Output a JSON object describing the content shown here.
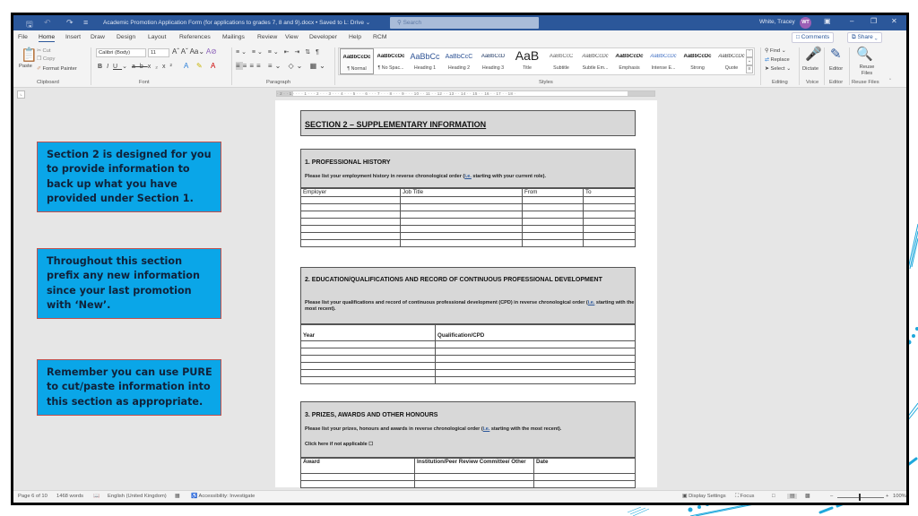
{
  "window": {
    "title": "Academic Promotion Application Form (for applications to grades 7, 8 and 9).docx • Saved to L: Drive ⌄",
    "search_placeholder": "Search",
    "user_name": "White, Tracey",
    "user_initials": "WT",
    "accent_color": "#2b579a"
  },
  "ribbon_tabs": [
    "File",
    "Home",
    "Insert",
    "Draw",
    "Design",
    "Layout",
    "References",
    "Mailings",
    "Review",
    "View",
    "Developer",
    "Help",
    "RCM"
  ],
  "active_tab": "Home",
  "top_buttons": {
    "comments": "Comments",
    "share": "Share"
  },
  "clipboard": {
    "paste": "Paste",
    "cut": "Cut",
    "copy": "Copy",
    "format_painter": "Format Painter",
    "label": "Clipboard"
  },
  "font": {
    "name": "Calibri (Body)",
    "size": "11",
    "label": "Font"
  },
  "paragraph": {
    "label": "Paragraph"
  },
  "styles": {
    "label": "Styles",
    "items": [
      {
        "preview": "AaBbCcDc",
        "name": "¶ Normal"
      },
      {
        "preview": "AaBbCcDc",
        "name": "¶ No Spac..."
      },
      {
        "preview": "AaBbCc",
        "name": "Heading 1"
      },
      {
        "preview": "AaBbCcC",
        "name": "Heading 2"
      },
      {
        "preview": "AaBbCcD",
        "name": "Heading 3"
      },
      {
        "preview": "AaB",
        "name": "Title"
      },
      {
        "preview": "AaBbCcC",
        "name": "Subtitle"
      },
      {
        "preview": "AaBbCcDc",
        "name": "Subtle Em..."
      },
      {
        "preview": "AaBbCcDc",
        "name": "Emphasis"
      },
      {
        "preview": "AaBbCcDc",
        "name": "Intense E..."
      },
      {
        "preview": "AaBbCcDc",
        "name": "Strong"
      },
      {
        "preview": "AaBbCcDc",
        "name": "Quote"
      }
    ]
  },
  "editing": {
    "find": "Find",
    "replace": "Replace",
    "select": "Select",
    "label": "Editing"
  },
  "voice": {
    "dictate": "Dictate",
    "label": "Voice"
  },
  "editor_group": {
    "editor": "Editor",
    "label": "Editor"
  },
  "reuse": {
    "button": "Reuse Files",
    "label": "Reuse Files"
  },
  "ruler_text": "· 2 · · 1 · · · · 1 · · · 2 · · · 3 · · · 4 · · · 5 · · · 6 · · · 7 · · · 8 · · · 9 · · · 10 · · 11 · · 12 · · 13 · · 14 · · 15 · · 16 · · 17 · · 18 ·",
  "callouts": [
    "Section 2 is designed for you to provide information to back up what you have provided under Section 1.",
    "Throughout this section prefix any new information since your last promotion with ‘New’.",
    "Remember you can use PURE to cut/paste information into this section as appropriate."
  ],
  "document": {
    "section_title": "SECTION 2 – SUPPLEMENTARY INFORMATION",
    "professional_history": {
      "heading": "1. PROFESSIONAL HISTORY",
      "instruction_pre": "Please list your employment history in reverse chronological order (",
      "ie": "i.e.",
      "instruction_post": " starting with your current role).",
      "columns": [
        "Employer",
        "Job Title",
        "From",
        "To"
      ],
      "empty_rows": 7
    },
    "education": {
      "heading": "2. EDUCATION/QUALIFICATIONS AND RECORD OF CONTINUOUS PROFESSIONAL DEVELOPMENT",
      "instruction_pre": "Please list your qualifications and record of continuous professional development (CPD) in reverse chronological order (",
      "ie": "i.e.",
      "instruction_post": " starting with the most recent).",
      "columns": [
        "Year",
        "Qualification/CPD"
      ],
      "empty_rows": 6
    },
    "prizes": {
      "heading": "3. PRIZES, AWARDS AND OTHER HONOURS",
      "instruction_pre": "Please list your prizes, honours and awards in reverse chronological order (",
      "ie": "i.e.",
      "instruction_post": " starting with the most recent).",
      "not_applicable": "Click here if not applicable ☐",
      "columns": [
        "Award",
        "Institution/Peer Review Committee/ Other",
        "Date"
      ],
      "empty_rows": 2
    }
  },
  "status_bar": {
    "page": "Page 6 of 10",
    "words": "1468 words",
    "language": "English (United Kingdom)",
    "accessibility": "Accessibility: Investigate",
    "display_settings": "Display Settings",
    "focus": "Focus",
    "zoom": "100%"
  }
}
